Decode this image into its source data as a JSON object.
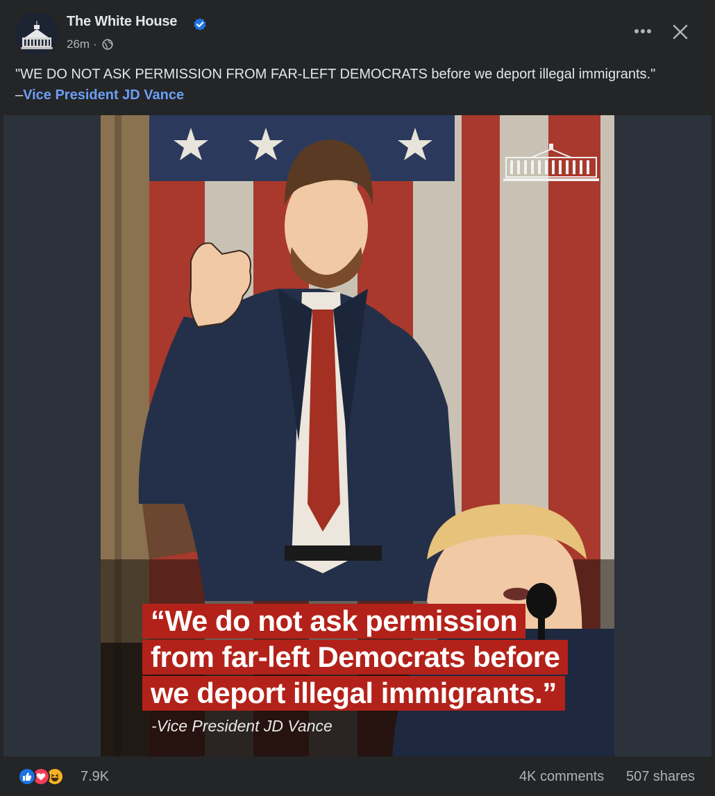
{
  "post": {
    "page_name": "The White House",
    "timestamp": "26m",
    "separator": "·",
    "caption": {
      "text": "\"WE DO NOT ASK PERMISSION FROM FAR-LEFT DEMOCRATS before we deport illegal immigrants.\"",
      "dash": "–",
      "link": "Vice President JD Vance"
    },
    "media": {
      "quote_lines": [
        "“We do not ask permission",
        "from far-left Democrats before",
        "we deport illegal immigrants.”"
      ],
      "attribution": "-Vice President JD Vance"
    },
    "footer": {
      "reaction_count": "7.9K",
      "comments": "4K comments",
      "shares": "507 shares"
    }
  },
  "icons": {
    "verified": "verified-badge-icon",
    "globe": "globe-icon",
    "more": "more-dots-icon",
    "close": "close-icon",
    "reactions": [
      "like-icon",
      "love-icon",
      "haha-icon"
    ]
  },
  "colors": {
    "background": "#242526",
    "text": "#e4e6eb",
    "secondary_text": "#b0b3b8",
    "link": "#6b9ff5",
    "verified": "#1b74e4",
    "quote_banner": "#b3221a",
    "media_frame": "#2c323b"
  }
}
